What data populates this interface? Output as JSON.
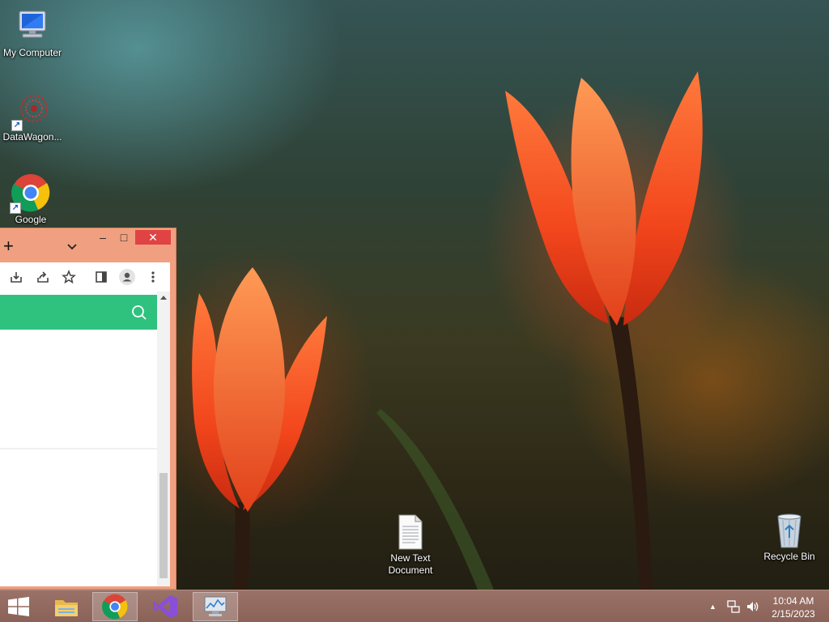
{
  "desktop": {
    "icons": [
      {
        "label": "My Computer",
        "icon": "computer-icon"
      },
      {
        "label": "DataWagon...",
        "icon": "datawagon-icon"
      },
      {
        "label": "Google",
        "icon": "chrome-icon"
      },
      {
        "label": "New Text Document",
        "icon": "text-document-icon"
      },
      {
        "label": "Recycle Bin",
        "icon": "recycle-bin-icon"
      }
    ]
  },
  "browser": {
    "new_tab_glyph": "+",
    "minimize_glyph": "–",
    "maximize_glyph": "□",
    "close_glyph": "✕",
    "search_bar_color": "#2ec27e"
  },
  "taskbar": {
    "items": [
      "start-button",
      "file-explorer",
      "google-chrome",
      "visual-studio",
      "resource-monitor"
    ],
    "clock_time": "10:04 AM",
    "clock_date": "2/15/2023",
    "tray_arrow": "▲"
  }
}
